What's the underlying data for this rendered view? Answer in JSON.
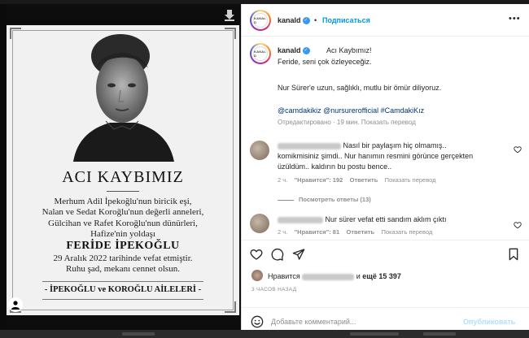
{
  "poster": {
    "title": "ACI KAYBIMIZ",
    "body_lines": [
      "Merhum Adil İpekoğlu'nun biricik eşi,",
      "Nalan ve Sedat Koroğlu'nun değerli anneleri,",
      "Gülcihan ve Rafet Koroğlu'nun dünürleri,",
      "Hafize'nin yoldaşı"
    ],
    "name": "FERİDE İPEKOĞLU",
    "body2_lines": [
      "29 Aralık 2022 tarihinde vefat etmiştir.",
      "Ruhu şad, mekanı cennet olsun."
    ],
    "families": "- İPEKOĞLU ve KOROĞLU AİLELERİ -"
  },
  "header": {
    "username": "kanald",
    "verified_icon": "verified-badge-icon",
    "dot": "•",
    "follow_label": "Подписаться",
    "more_label": "•••",
    "logo_text": "KANAL D"
  },
  "caption": {
    "username": "kanald",
    "line1": "Acı Kaybımız!",
    "line2": "Feride, seni çok özleyeceğiz.",
    "line3": "Nur Sürer'e uzun, sağlıklı, mutlu bir ömür diliyoruz.",
    "tags": "@camdakikiz @nursurerofficial #CamdakiKız",
    "meta": "Отредактировано · 19 мин.   Показать перевод"
  },
  "comments": [
    {
      "text_lines": [
        "Nasıl bir paylaşım hiç olmamış..",
        "komikmisiniz şimdi.. Nur hanımın resmini görünce gerçekten",
        "üzüldüm.. kaldırın bu postu bence.."
      ],
      "age": "2 ч.",
      "likes": "\"Нравится\": 192",
      "reply": "Ответить",
      "translate": "Показать перевод"
    },
    {
      "text_lines": [
        "Nur sürer vefat etti sandım aklım çıktı"
      ],
      "age": "2 ч.",
      "likes": "\"Нравится\": 81",
      "reply": "Ответить",
      "translate": "Показать перевод"
    }
  ],
  "view_replies": "Посмотреть ответы (13)",
  "likes": {
    "prefix": "Нравится",
    "suffix": "и",
    "others": "ещё 15 397"
  },
  "timestamp": "3 ЧАСОВ НАЗАД",
  "comment_box": {
    "placeholder": "Добавьте комментарий...",
    "publish_label": "Опубликовать"
  },
  "colors": {
    "accent": "#0095f6",
    "link": "#00376b",
    "muted": "#8e8e8e",
    "text": "#262626"
  }
}
